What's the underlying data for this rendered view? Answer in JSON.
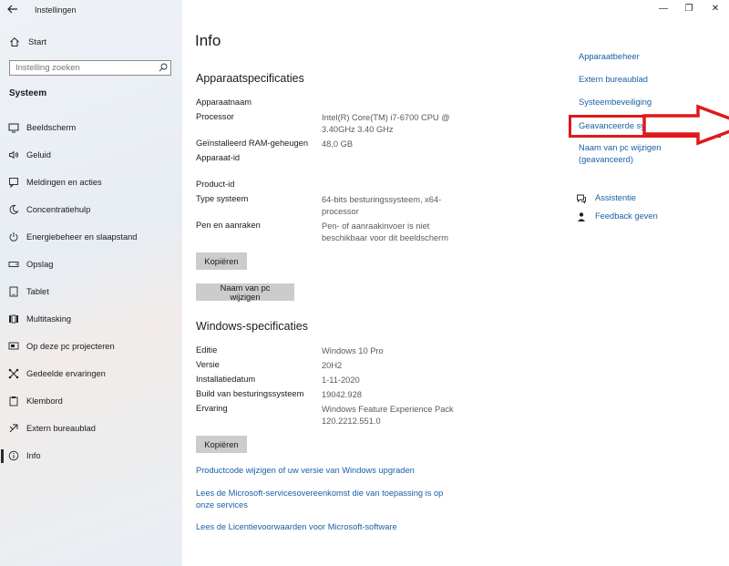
{
  "window": {
    "title": "Instellingen",
    "minimize_glyph": "—",
    "maximize_glyph": "❐",
    "close_glyph": "✕"
  },
  "sidebar": {
    "home_label": "Start",
    "search": {
      "placeholder": "Instelling zoeken",
      "value": ""
    },
    "section_title": "Systeem",
    "items": [
      {
        "label": "Beeldscherm",
        "icon": "monitor-icon"
      },
      {
        "label": "Geluid",
        "icon": "speaker-icon"
      },
      {
        "label": "Meldingen en acties",
        "icon": "notification-icon"
      },
      {
        "label": "Concentratiehulp",
        "icon": "moon-icon"
      },
      {
        "label": "Energiebeheer en slaapstand",
        "icon": "power-icon"
      },
      {
        "label": "Opslag",
        "icon": "storage-icon"
      },
      {
        "label": "Tablet",
        "icon": "tablet-icon"
      },
      {
        "label": "Multitasking",
        "icon": "multitasking-icon"
      },
      {
        "label": "Op deze pc projecteren",
        "icon": "project-icon"
      },
      {
        "label": "Gedeelde ervaringen",
        "icon": "shared-icon"
      },
      {
        "label": "Klembord",
        "icon": "clipboard-icon"
      },
      {
        "label": "Extern bureaublad",
        "icon": "remote-desktop-icon"
      },
      {
        "label": "Info",
        "icon": "info-icon",
        "active": true
      }
    ]
  },
  "main": {
    "title": "Info",
    "device_specs": {
      "heading": "Apparaatspecificaties",
      "rows": [
        {
          "key": "Apparaatnaam",
          "value": ""
        },
        {
          "key": "Processor",
          "value": "Intel(R) Core(TM) i7-6700 CPU @ 3.40GHz   3.40 GHz"
        },
        {
          "key": "Geïnstalleerd RAM-geheugen",
          "value": "48,0 GB"
        },
        {
          "key": "Apparaat-id",
          "value": ""
        },
        {
          "key": "Product-id",
          "value": ""
        },
        {
          "key": "Type systeem",
          "value": "64-bits besturingssysteem, x64-processor"
        },
        {
          "key": "Pen en aanraken",
          "value": "Pen- of aanraakinvoer is niet beschikbaar voor dit beeldscherm"
        }
      ],
      "copy_button": "Kopiëren",
      "rename_button": "Naam van pc wijzigen"
    },
    "windows_specs": {
      "heading": "Windows-specificaties",
      "rows": [
        {
          "key": "Editie",
          "value": "Windows 10 Pro"
        },
        {
          "key": "Versie",
          "value": "20H2"
        },
        {
          "key": "Installatiedatum",
          "value": "1-11-2020"
        },
        {
          "key": "Build van besturingssysteem",
          "value": "19042.928"
        },
        {
          "key": "Ervaring",
          "value": "Windows Feature Experience Pack 120.2212.551.0"
        }
      ],
      "copy_button": "Kopiëren"
    },
    "links": [
      "Productcode wijzigen of uw versie van Windows upgraden",
      "Lees de Microsoft-servicesovereenkomst die van toepassing is op onze services",
      "Lees de Licentievoorwaarden voor Microsoft-software"
    ]
  },
  "related": {
    "links": [
      "Apparaatbeheer",
      "Extern bureaublad",
      "Systeembeveiliging",
      "Geavanceerde systeeminstellingen",
      "Naam van pc wijzigen (geavanceerd)"
    ],
    "help": [
      {
        "label": "Assistentie",
        "icon": "chat-help-icon"
      },
      {
        "label": "Feedback geven",
        "icon": "feedback-icon"
      }
    ]
  },
  "annotation": {
    "highlight_color": "#e0191b"
  },
  "colors": {
    "link": "#1a5fa5",
    "button": "#cccccc",
    "sidebar_bg": "#eef2f7"
  }
}
